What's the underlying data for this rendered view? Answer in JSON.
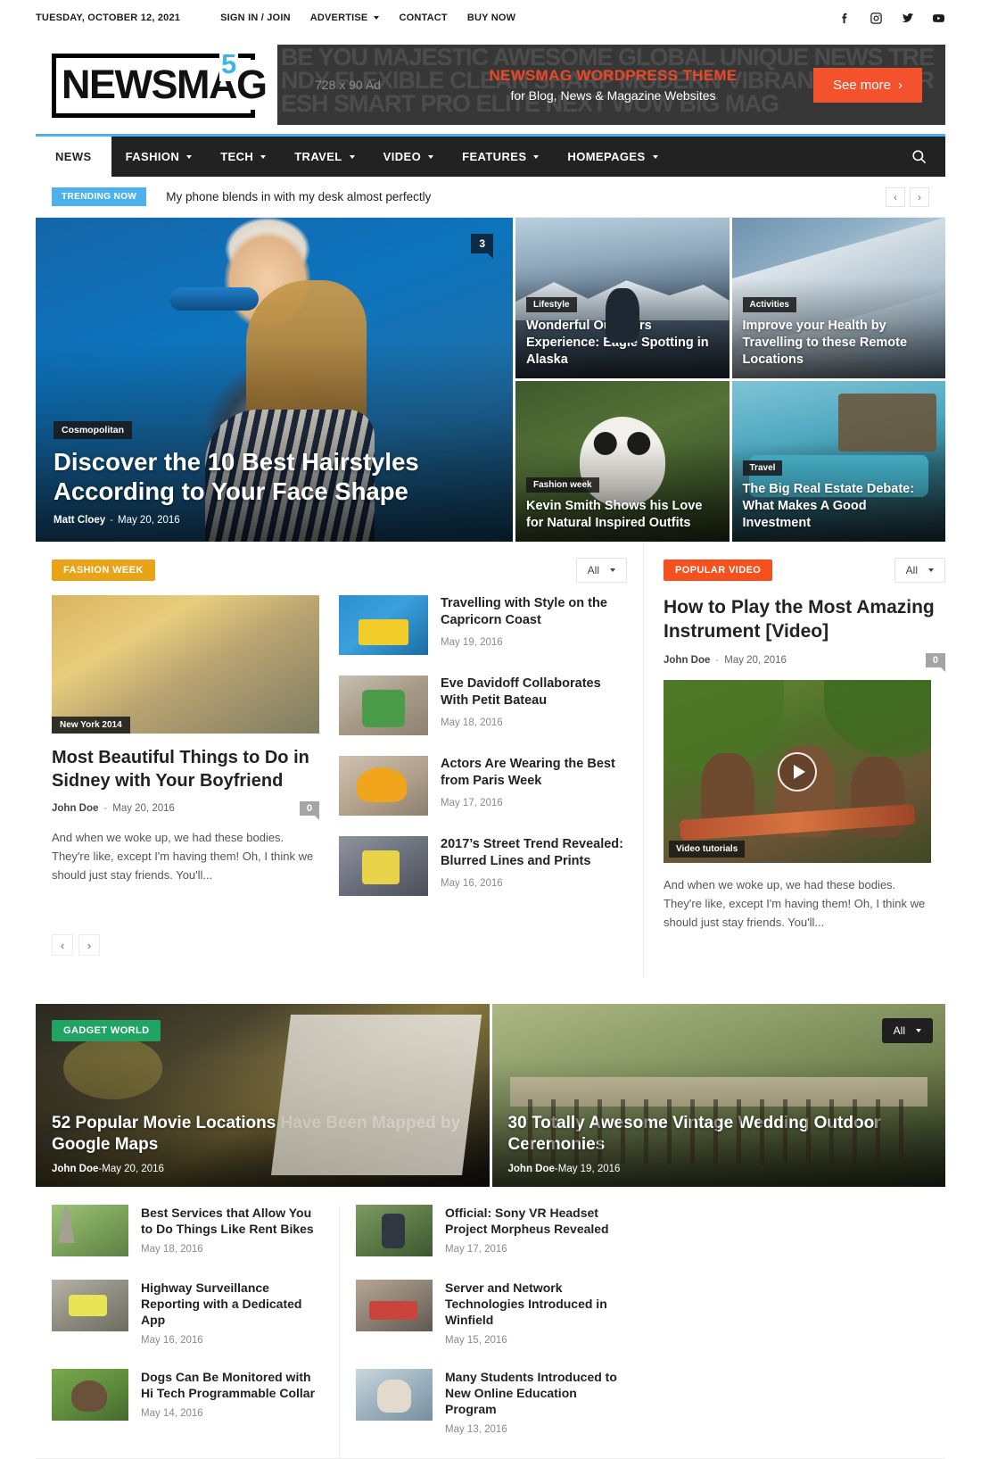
{
  "topbar": {
    "date": "TUESDAY, OCTOBER 12, 2021",
    "links": [
      {
        "label": "SIGN IN / JOIN",
        "caret": false
      },
      {
        "label": "ADVERTISE",
        "caret": true
      },
      {
        "label": "CONTACT",
        "caret": false
      },
      {
        "label": "BUY NOW",
        "caret": false
      }
    ],
    "social": [
      "facebook-icon",
      "instagram-icon",
      "twitter-icon",
      "youtube-icon"
    ]
  },
  "logo": {
    "word": "NEWSMAG",
    "superscript": "5",
    "accent": "#3fb4e8"
  },
  "ad": {
    "size_label": "728 x 90 Ad",
    "title": "NEWSMAG WORDPRESS THEME",
    "subtitle": "for Blog, News & Magazine Websites",
    "button": "See more",
    "title_color": "#ef4623",
    "button_color": "#f4522d"
  },
  "nav": {
    "items": [
      {
        "label": "NEWS",
        "caret": false,
        "active": true
      },
      {
        "label": "FASHION",
        "caret": true,
        "active": false
      },
      {
        "label": "TECH",
        "caret": true,
        "active": false
      },
      {
        "label": "TRAVEL",
        "caret": true,
        "active": false
      },
      {
        "label": "VIDEO",
        "caret": true,
        "active": false
      },
      {
        "label": "FEATURES",
        "caret": true,
        "active": false
      },
      {
        "label": "HOMEPAGES",
        "caret": true,
        "active": false
      }
    ],
    "accent": "#4db2ec"
  },
  "trending": {
    "badge": "TRENDING NOW",
    "headline": "My phone blends in with my desk almost perfectly",
    "prev": "‹",
    "next": "›"
  },
  "hero": {
    "featured": {
      "category": "Cosmopolitan",
      "title": "Discover the 10 Best Hairstyles According to Your Face Shape",
      "author": "Matt Cloey",
      "date": "May 20, 2016",
      "comments": "3"
    },
    "side": [
      {
        "category": "Lifestyle",
        "title": "Wonderful Outdoors Experience: Eagle Spotting in Alaska",
        "img": "img-alaska"
      },
      {
        "category": "Activities",
        "title": "Improve your Health by Travelling to these Remote Locations",
        "img": "img-plane"
      },
      {
        "category": "Fashion week",
        "title": "Kevin Smith Shows his Love for Natural Inspired Outfits",
        "img": "img-panda"
      },
      {
        "category": "Travel",
        "title": "The Big Real Estate Debate: What Makes A Good Investment",
        "img": "img-pool"
      }
    ]
  },
  "fashion_week": {
    "badge": "FASHION WEEK",
    "badge_color": "#e8a317",
    "filter": "All",
    "feature": {
      "category": "New York 2014",
      "title": "Most Beautiful Things to Do in Sidney with Your Boyfriend",
      "author": "John Doe",
      "date": "May 20, 2016",
      "comments": "0",
      "excerpt": "And when we woke up, we had these bodies. They're like, except I'm having them! Oh, I think we should just stay friends. You'll..."
    },
    "posts": [
      {
        "title": "Travelling with Style on the Capricorn Coast",
        "date": "May 19, 2016",
        "img": "t-bag"
      },
      {
        "title": "Eve Davidoff Collaborates With Petit Bateau",
        "date": "May 18, 2016",
        "img": "t-boy"
      },
      {
        "title": "Actors Are Wearing the Best from Paris Week",
        "date": "May 17, 2016",
        "img": "t-dog"
      },
      {
        "title": "2017’s Street Trend Revealed: Blurred Lines and Prints",
        "date": "May 16, 2016",
        "img": "t-street"
      }
    ],
    "prev": "‹",
    "next": "›"
  },
  "popular_video": {
    "badge": "POPULAR VIDEO",
    "badge_color": "#f4511e",
    "filter": "All",
    "title": "How to Play the Most Amazing Instrument [Video]",
    "author": "John Doe",
    "date": "May 20, 2016",
    "comments": "0",
    "video_category": "Video tutorials",
    "excerpt": "And when we woke up, we had these bodies. They're like, except I'm having them! Oh, I think we should just stay friends. You'll..."
  },
  "gadget_world": {
    "badge": "GADGET WORLD",
    "badge_color": "#1fa463",
    "filter": "All",
    "cards": [
      {
        "title": "52 Popular Movie Locations Have Been Mapped by Google Maps",
        "author": "John Doe",
        "date": "May 20, 2016",
        "img": "img-desk"
      },
      {
        "title": "30 Totally Awesome Vintage Wedding Outdoor Ceremonies",
        "author": "John Doe",
        "date": "May 19, 2016",
        "img": "img-wedding"
      }
    ],
    "left_posts": [
      {
        "title": "Best Services that Allow You to Do Things Like Rent Bikes",
        "date": "May 18, 2016",
        "img": "t-eiffel"
      },
      {
        "title": "Highway Surveillance Reporting with a Dedicated App",
        "date": "May 16, 2016",
        "img": "t-laptop"
      },
      {
        "title": "Dogs Can Be Monitored with Hi Tech Programmable Collar",
        "date": "May 14, 2016",
        "img": "t-collar"
      }
    ],
    "right_posts": [
      {
        "title": "Official: Sony VR Headset Project Morpheus Revealed",
        "date": "May 17, 2016",
        "img": "t-vr"
      },
      {
        "title": "Server and Network Technologies Introduced in Winfield",
        "date": "May 15, 2016",
        "img": "t-server"
      },
      {
        "title": "Many Students Introduced to New Online Education Program",
        "date": "May 13, 2016",
        "img": "t-student"
      }
    ]
  },
  "separator": "-"
}
